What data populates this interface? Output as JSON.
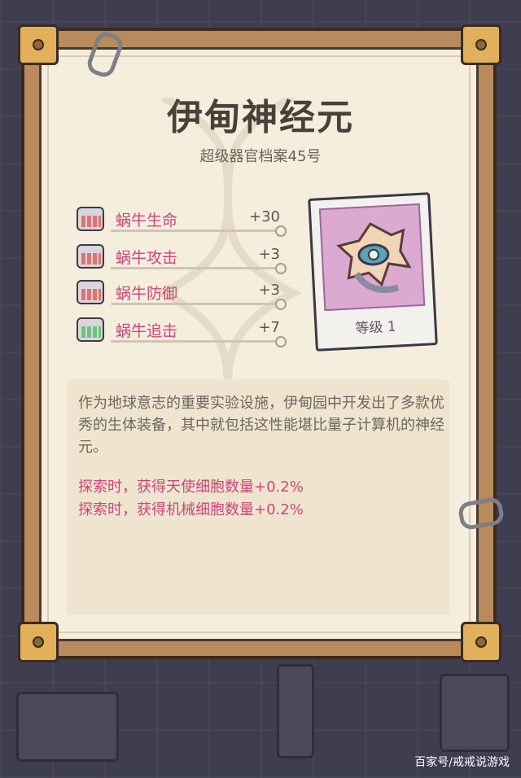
{
  "item": {
    "title": "伊甸神经元",
    "subtitle": "超级器官档案45号",
    "grade": "等级 1",
    "image_icon": "neuron-device-icon"
  },
  "stats": [
    {
      "name": "蜗牛生命",
      "value": "+30",
      "icon": "health-stat-icon"
    },
    {
      "name": "蜗牛攻击",
      "value": "+3",
      "icon": "attack-stat-icon"
    },
    {
      "name": "蜗牛防御",
      "value": "+3",
      "icon": "defense-stat-icon"
    },
    {
      "name": "蜗牛追击",
      "value": "+7",
      "icon": "pursuit-stat-icon"
    }
  ],
  "description": "作为地球意志的重要实验设施，伊甸园中开发出了多款优秀的生体装备，其中就包括这性能堪比量子计算机的神经元。",
  "effects": [
    "探索时，获得天使细胞数量+0.2%",
    "探索时，获得机械细胞数量+0.2%"
  ],
  "watermark": "百家号/戒戒说游戏",
  "colors": {
    "accent_pink": "#c8467a",
    "panel_bg": "#f5eedd",
    "frame_wood": "#b98a5c",
    "background": "#3f3d50"
  }
}
